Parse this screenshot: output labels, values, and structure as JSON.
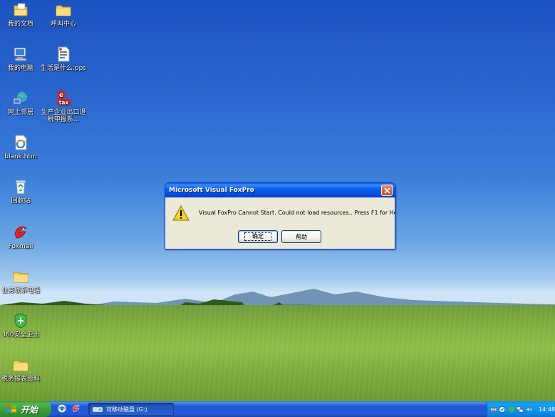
{
  "desktop": {
    "icons": [
      {
        "label": "我的文档",
        "icon": "my-documents-icon"
      },
      {
        "label": "呼叫中心",
        "icon": "folder-icon"
      },
      {
        "label": "我的电脑",
        "icon": "my-computer-icon"
      },
      {
        "label": "生活是什么.pps",
        "icon": "pps-file-icon"
      },
      {
        "label": "网上邻居",
        "icon": "network-places-icon"
      },
      {
        "label": "生产企业出口退税申报系...",
        "icon": "etax-icon"
      },
      {
        "label": "blank.htm",
        "icon": "ie-document-icon"
      },
      {
        "label": "回收站",
        "icon": "recycle-bin-icon"
      },
      {
        "label": "Foxmail",
        "icon": "foxmail-icon"
      },
      {
        "label": "业务联系电话",
        "icon": "folder-icon"
      },
      {
        "label": "360安全卫士",
        "icon": "360-safe-icon"
      },
      {
        "label": "税务报表资料",
        "icon": "folder-icon"
      }
    ]
  },
  "dialog": {
    "title": "Microsoft Visual FoxPro",
    "message": "Visual FoxPro Cannot Start. Could not load resources.. Press F1 for Help.",
    "ok_label": "确定",
    "help_label": "帮助",
    "icon": "warning-icon"
  },
  "taskbar": {
    "start_label": "开始",
    "tasks": [
      {
        "label": "可移动磁盘 (G:)",
        "icon": "removable-drive-icon"
      }
    ],
    "clock": "14:48"
  },
  "colors": {
    "titlebar": "#0a5fef",
    "taskbar": "#2257d5",
    "start": "#3c9a3c",
    "tray": "#0f8ff0",
    "dialog_bg": "#ece9d8"
  }
}
